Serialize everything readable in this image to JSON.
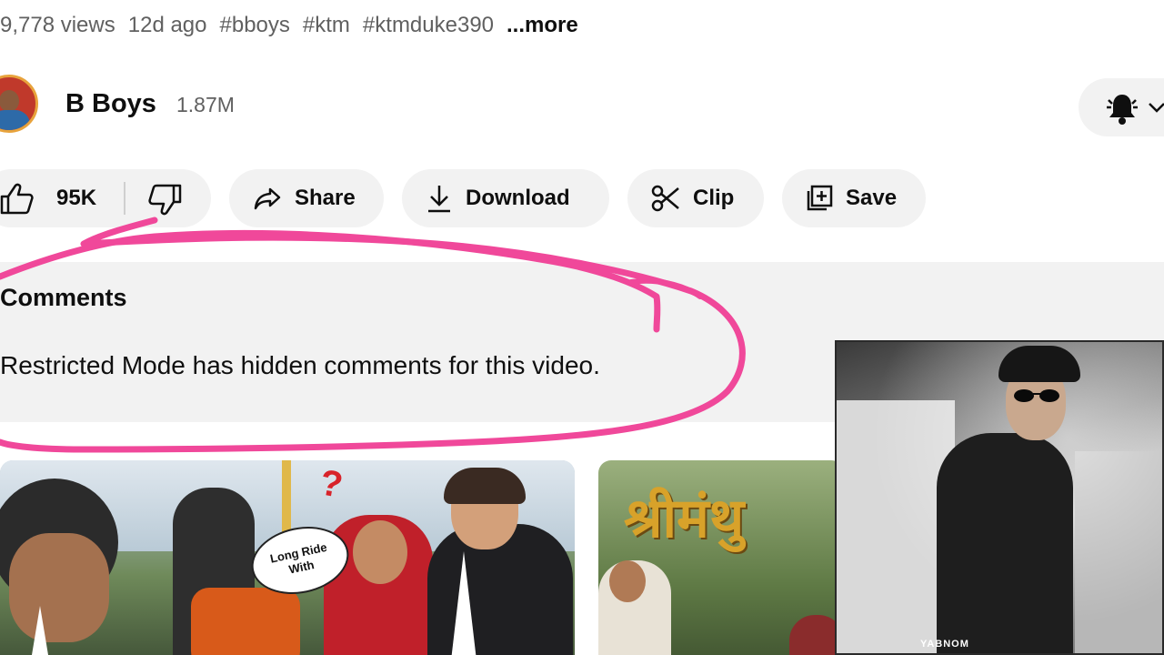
{
  "video_meta": {
    "views": "9,778 views",
    "age": "12d ago",
    "hashtags": [
      "#bboys",
      "#ktm",
      "#ktmduke390"
    ],
    "more_label": "...more"
  },
  "channel": {
    "name": "B Boys",
    "subscribers": "1.87M",
    "notification_icon": "bell-icon"
  },
  "actions": {
    "like_count": "95K",
    "share_label": "Share",
    "download_label": "Download",
    "clip_label": "Clip",
    "save_label": "Save"
  },
  "comments": {
    "title": "Comments",
    "restricted_message": "Restricted Mode has hidden comments for this video."
  },
  "recommendations": {
    "thumb1_badge_line1": "Long Ride",
    "thumb1_badge_line2": "With",
    "thumb1_mark": "?",
    "thumb2_title": "श्रीमंथु"
  },
  "overlay_video": {
    "watermark": "YABNOM"
  },
  "colors": {
    "annotation": "#f0489a",
    "pill_background": "#f2f2f2",
    "comments_background": "#f2f2f2",
    "secondary_text": "#606060"
  }
}
